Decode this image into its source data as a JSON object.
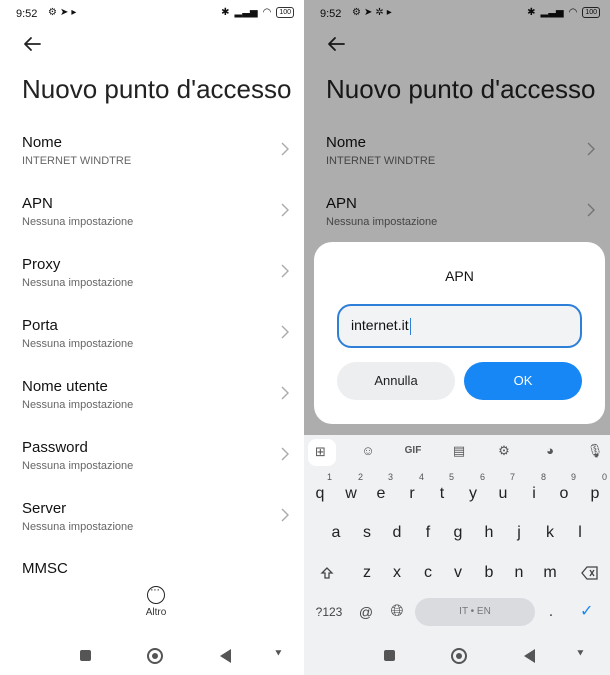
{
  "left": {
    "status": {
      "time": "9:52",
      "battery": "100"
    },
    "title": "Nuovo punto d'accesso",
    "rows": [
      {
        "label": "Nome",
        "value": "INTERNET WINDTRE"
      },
      {
        "label": "APN",
        "value": "Nessuna impostazione"
      },
      {
        "label": "Proxy",
        "value": "Nessuna impostazione"
      },
      {
        "label": "Porta",
        "value": "Nessuna impostazione"
      },
      {
        "label": "Nome utente",
        "value": "Nessuna impostazione"
      },
      {
        "label": "Password",
        "value": "Nessuna impostazione"
      },
      {
        "label": "Server",
        "value": "Nessuna impostazione"
      }
    ],
    "partial_row": "MMSC",
    "more_label": "Altro"
  },
  "right": {
    "status": {
      "time": "9:52",
      "battery": "100"
    },
    "title": "Nuovo punto d'accesso",
    "rows": [
      {
        "label": "Nome",
        "value": "INTERNET WINDTRE"
      },
      {
        "label": "APN",
        "value": "Nessuna impostazione"
      }
    ],
    "dialog": {
      "title": "APN",
      "input_value": "internet.it",
      "cancel_label": "Annulla",
      "ok_label": "OK"
    },
    "keyboard": {
      "toolbar_gif": "GIF",
      "row1": [
        "q",
        "w",
        "e",
        "r",
        "t",
        "y",
        "u",
        "i",
        "o",
        "p"
      ],
      "row1_hints": [
        "1",
        "2",
        "3",
        "4",
        "5",
        "6",
        "7",
        "8",
        "9",
        "0"
      ],
      "row2": [
        "a",
        "s",
        "d",
        "f",
        "g",
        "h",
        "j",
        "k",
        "l"
      ],
      "row3": [
        "z",
        "x",
        "c",
        "v",
        "b",
        "n",
        "m"
      ],
      "symbols_key": "?123",
      "at_key": "@",
      "space_label": "IT • EN",
      "period_key": "."
    }
  },
  "colors": {
    "accent": "#1787f5",
    "input_border": "#2e7fd8",
    "dim_overlay": "rgba(0,0,0,0.32)"
  }
}
